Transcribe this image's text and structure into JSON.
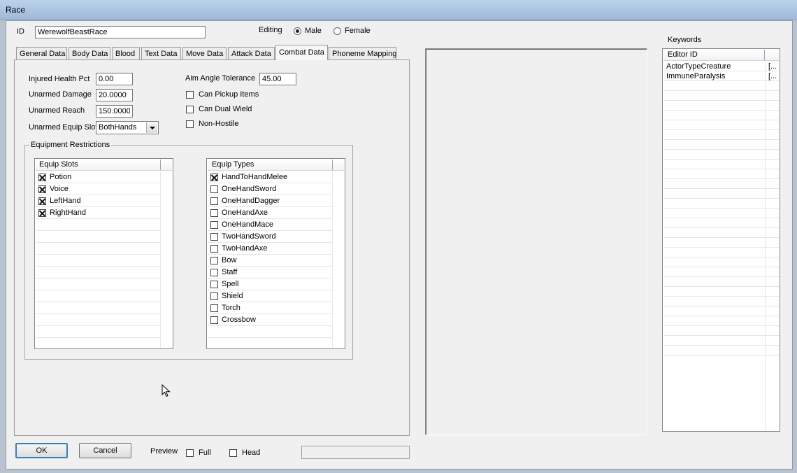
{
  "window": {
    "title": "Race"
  },
  "id_field": {
    "label": "ID",
    "value": "WerewolfBeastRace"
  },
  "editing": {
    "label": "Editing",
    "male_label": "Male",
    "female_label": "Female",
    "selected": "Male"
  },
  "tabs": [
    {
      "label": "General Data"
    },
    {
      "label": "Body Data"
    },
    {
      "label": "Blood"
    },
    {
      "label": "Text Data"
    },
    {
      "label": "Move Data"
    },
    {
      "label": "Attack Data"
    },
    {
      "label": "Combat Data",
      "active": true
    },
    {
      "label": "Phoneme Mapping"
    }
  ],
  "combat": {
    "injured_health_pct": {
      "label": "Injured Health Pct",
      "value": "0.00"
    },
    "unarmed_damage": {
      "label": "Unarmed Damage",
      "value": "20.0000"
    },
    "unarmed_reach": {
      "label": "Unarmed Reach",
      "value": "150.0000"
    },
    "unarmed_equip_slot": {
      "label": "Unarmed Equip Slot",
      "value": "BothHands"
    },
    "aim_angle_tolerance": {
      "label": "Aim Angle Tolerance",
      "value": "45.00"
    },
    "can_pickup_items": {
      "label": "Can Pickup Items",
      "checked": false
    },
    "can_dual_wield": {
      "label": "Can Dual Wield",
      "checked": false
    },
    "non_hostile": {
      "label": "Non-Hostile",
      "checked": false
    }
  },
  "equipment_restrictions": {
    "label": "Equipment Restrictions",
    "equip_slots": {
      "header": "Equip Slots",
      "items": [
        {
          "label": "Potion",
          "checked": true
        },
        {
          "label": "Voice",
          "checked": true
        },
        {
          "label": "LeftHand",
          "checked": true
        },
        {
          "label": "RightHand",
          "checked": true
        }
      ]
    },
    "equip_types": {
      "header": "Equip Types",
      "items": [
        {
          "label": "HandToHandMelee",
          "checked": true
        },
        {
          "label": "OneHandSword",
          "checked": false
        },
        {
          "label": "OneHandDagger",
          "checked": false
        },
        {
          "label": "OneHandAxe",
          "checked": false
        },
        {
          "label": "OneHandMace",
          "checked": false
        },
        {
          "label": "TwoHandSword",
          "checked": false
        },
        {
          "label": "TwoHandAxe",
          "checked": false
        },
        {
          "label": "Bow",
          "checked": false
        },
        {
          "label": "Staff",
          "checked": false
        },
        {
          "label": "Spell",
          "checked": false
        },
        {
          "label": "Shield",
          "checked": false
        },
        {
          "label": "Torch",
          "checked": false
        },
        {
          "label": "Crossbow",
          "checked": false
        }
      ]
    }
  },
  "keywords": {
    "label": "Keywords",
    "header": "Editor ID",
    "items": [
      {
        "editor_id": "ActorTypeCreature",
        "extra": "[..."
      },
      {
        "editor_id": "ImmuneParalysis",
        "extra": "[..."
      }
    ]
  },
  "buttons": {
    "ok": "OK",
    "cancel": "Cancel"
  },
  "preview": {
    "label": "Preview",
    "full_label": "Full",
    "head_label": "Head",
    "full_checked": false,
    "head_checked": false
  },
  "icons": {
    "cursor": "mouse-pointer-icon"
  }
}
